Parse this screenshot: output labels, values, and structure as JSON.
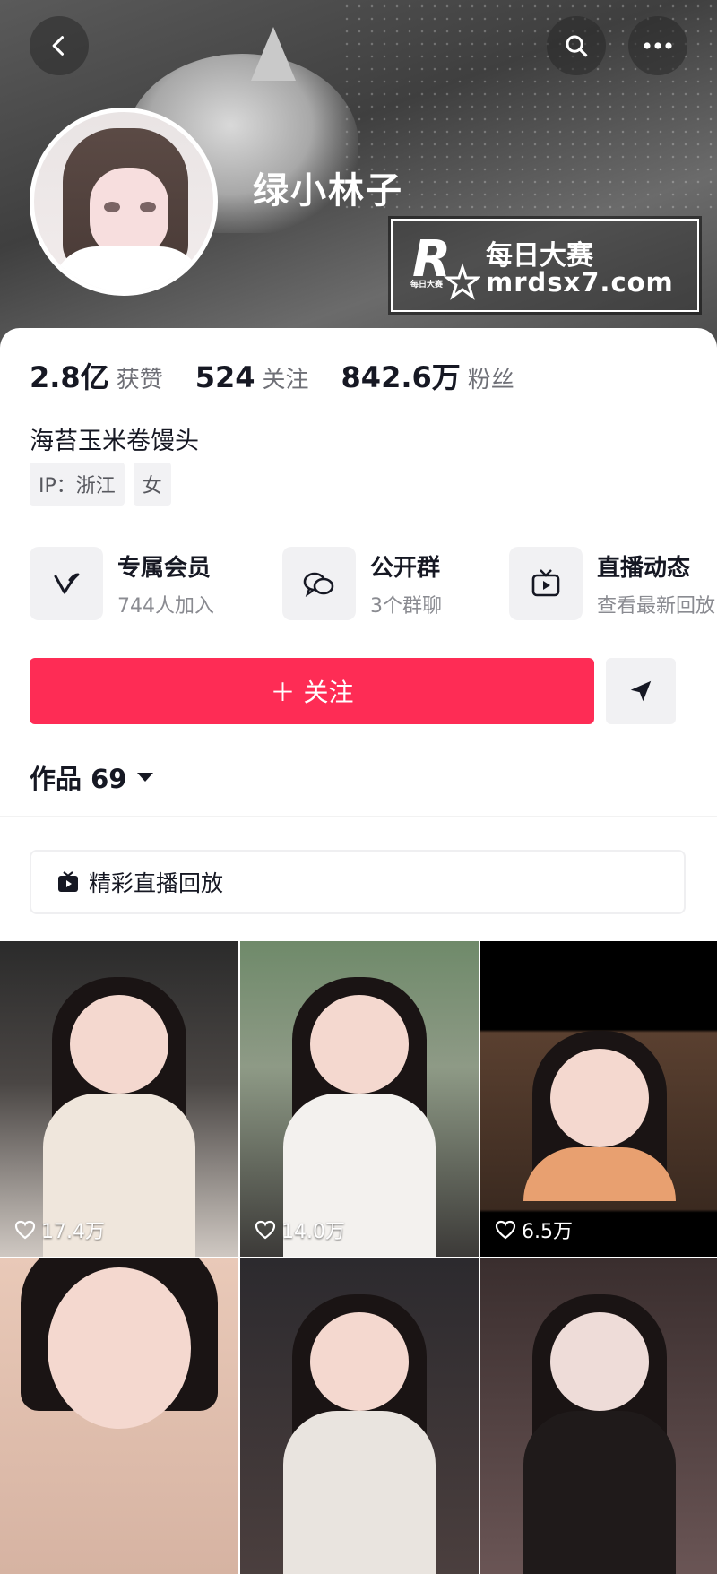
{
  "header": {
    "username": "绿小林子",
    "watermark": {
      "line1": "每日大赛",
      "line2": "mrdsx7.com",
      "logo_letter": "R",
      "logo_small": "每日大赛"
    }
  },
  "icons": {
    "back": "chevron-left-icon",
    "search": "search-icon",
    "more": "more-dots-icon"
  },
  "stats": [
    {
      "value": "2.8亿",
      "label": "获赞"
    },
    {
      "value": "524",
      "label": "关注"
    },
    {
      "value": "842.6万",
      "label": "粉丝"
    }
  ],
  "bio": "海苔玉米卷馒头",
  "tags": [
    "IP：浙江",
    "女"
  ],
  "features": [
    {
      "title": "专属会员",
      "subtitle": "744人加入",
      "icon": "member-v-icon"
    },
    {
      "title": "公开群",
      "subtitle": "3个群聊",
      "icon": "group-chat-icon"
    },
    {
      "title": "直播动态",
      "subtitle": "查看最新回放",
      "icon": "live-tv-icon"
    }
  ],
  "actions": {
    "follow_label": "＋ 关注",
    "share_icon": "send-icon"
  },
  "works": {
    "label": "作品 69"
  },
  "replay": {
    "label": "精彩直播回放"
  },
  "videos": [
    {
      "likes": "17.4万"
    },
    {
      "likes": "14.0万"
    },
    {
      "likes": "6.5万"
    },
    {
      "likes": ""
    },
    {
      "likes": ""
    },
    {
      "likes": ""
    }
  ],
  "colors": {
    "primary": "#fe2c55",
    "text": "#161823",
    "secondary": "#6f7077"
  }
}
